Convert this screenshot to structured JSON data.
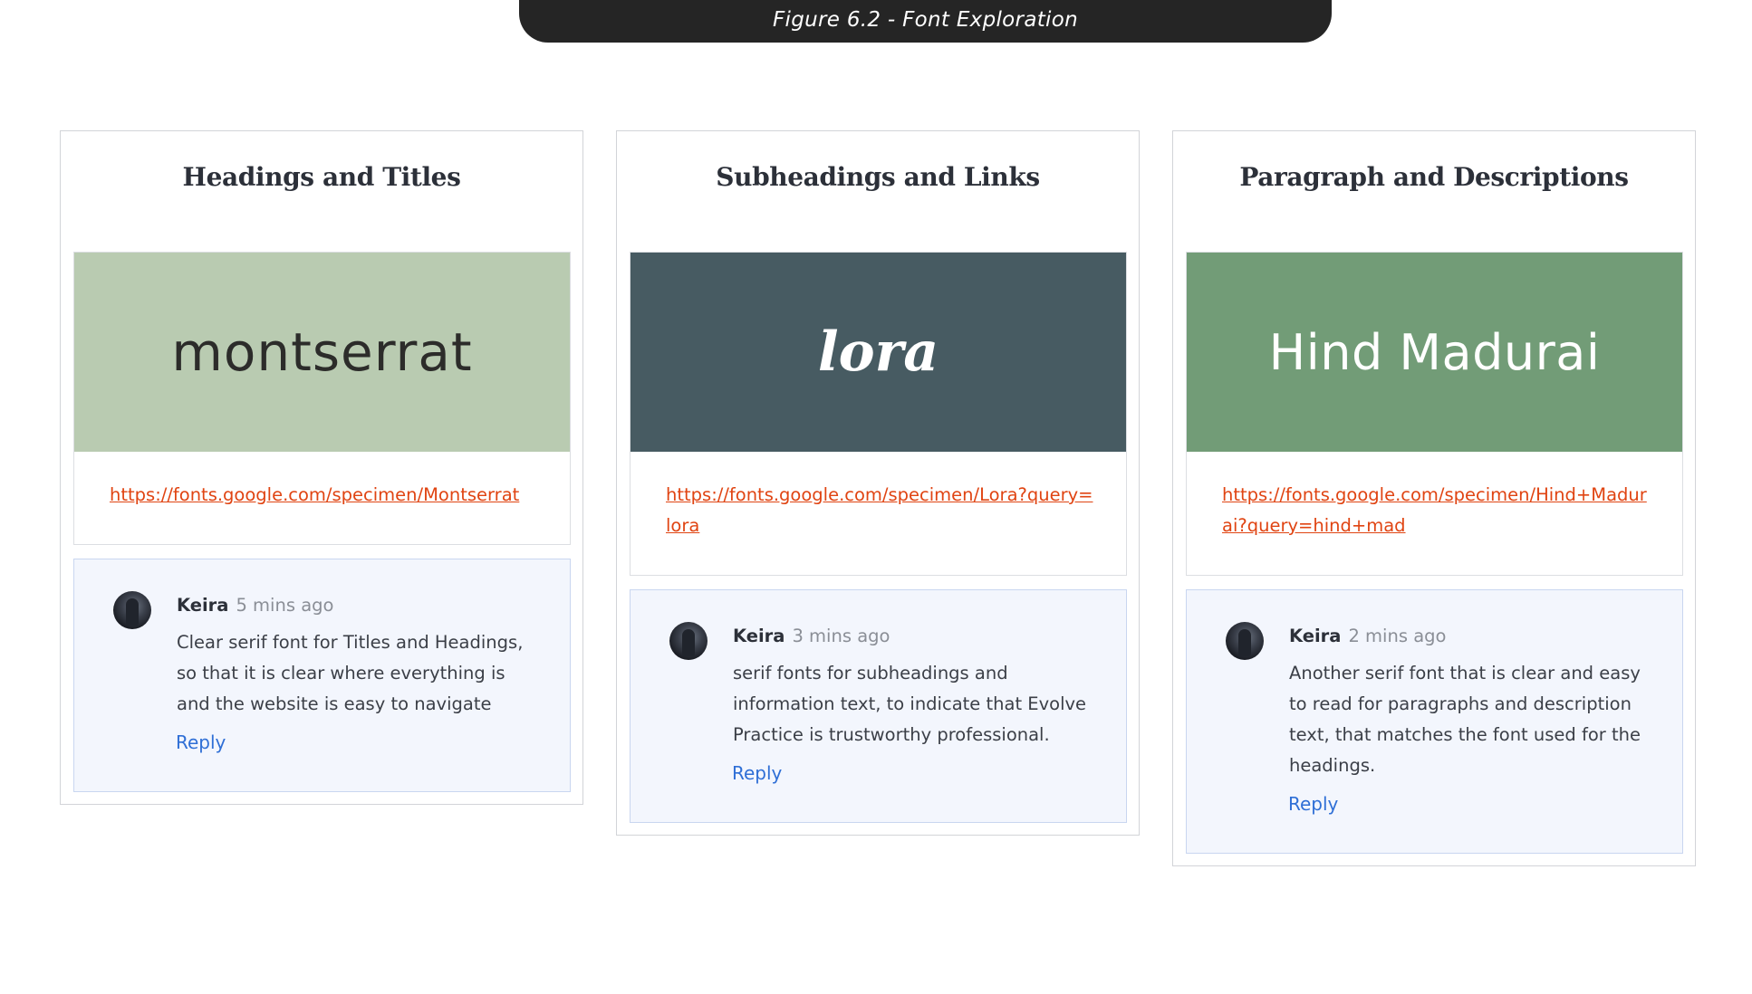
{
  "figure": {
    "caption": "Figure 6.2 - Font Exploration"
  },
  "columns": [
    {
      "title": "Headings and Titles",
      "font_name": "montserrat",
      "link": "https://fonts.google.com/specimen/Montserrat",
      "swatch_color": "#b9cbb1",
      "comment": {
        "author": "Keira",
        "time": "5 mins ago",
        "text": "Clear serif font for Titles and Headings, so that it is clear where everything is and the website is easy to navigate",
        "reply_label": "Reply"
      }
    },
    {
      "title": "Subheadings and Links",
      "font_name": "lora",
      "link": "https://fonts.google.com/specimen/Lora?query=lora",
      "swatch_color": "#475b62",
      "comment": {
        "author": "Keira",
        "time": "3 mins ago",
        "text": "serif fonts for subheadings and information text, to indicate that Evolve Practice is trustworthy professional.",
        "reply_label": "Reply"
      }
    },
    {
      "title": "Paragraph and Descriptions",
      "font_name": "Hind Madurai",
      "link": "https://fonts.google.com/specimen/Hind+Madurai?query=hind+mad",
      "swatch_color": "#729c77",
      "comment": {
        "author": "Keira",
        "time": "2 mins ago",
        "text": "Another serif font that is clear and easy to read for paragraphs  and description text, that matches the font used for the headings.",
        "reply_label": "Reply"
      }
    }
  ],
  "colors": {
    "banner": "#252525",
    "link": "#e04412",
    "reply": "#2f6fd6",
    "comment_bg": "#f3f6fd"
  }
}
